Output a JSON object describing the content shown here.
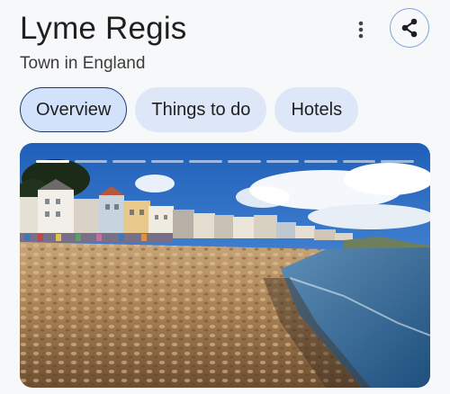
{
  "header": {
    "title": "Lyme Regis",
    "subtitle": "Town in England",
    "more_icon": "more-vertical-icon",
    "share_icon": "share-icon"
  },
  "tabs": [
    {
      "label": "Overview",
      "selected": true
    },
    {
      "label": "Things to do",
      "selected": false
    },
    {
      "label": "Hotels",
      "selected": false
    }
  ],
  "gallery": {
    "image": "beach-photo",
    "slide_count": 10,
    "current_slide": 1
  },
  "colors": {
    "accent": "#1f3a66",
    "chip_bg": "#dde7f8",
    "share_border": "#7da3d8"
  }
}
